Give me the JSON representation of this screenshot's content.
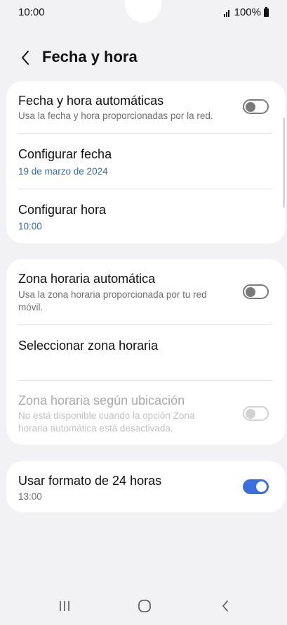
{
  "status_bar": {
    "time": "10:00",
    "battery": "100%"
  },
  "header": {
    "title": "Fecha y hora"
  },
  "section1": {
    "auto_datetime": {
      "title": "Fecha y hora automáticas",
      "subtitle": "Usa la fecha y hora proporcionadas por la red.",
      "enabled": false
    },
    "set_date": {
      "title": "Configurar fecha",
      "value": "19 de marzo de 2024"
    },
    "set_time": {
      "title": "Configurar hora",
      "value": "10:00"
    }
  },
  "section2": {
    "auto_timezone": {
      "title": "Zona horaria automática",
      "subtitle": "Usa la zona horaria proporcionada por tu red móvil.",
      "enabled": false
    },
    "select_timezone": {
      "title": "Seleccionar zona horaria"
    },
    "location_timezone": {
      "title": "Zona horaria según ubicación",
      "subtitle": "No está disponible cuando la opción Zona horaria automática está desactivada.",
      "enabled": false,
      "disabled": true
    }
  },
  "section3": {
    "format24": {
      "title": "Usar formato de 24 horas",
      "value": "13:00",
      "enabled": true
    }
  },
  "colors": {
    "accent": "#3a6fe0",
    "link_blue": "#2f6fb0",
    "background": "#f2f2f4"
  },
  "icons": {
    "back": "chevron-left-icon",
    "nav_recents": "recents-icon",
    "nav_home": "home-icon",
    "nav_back": "back-icon"
  }
}
